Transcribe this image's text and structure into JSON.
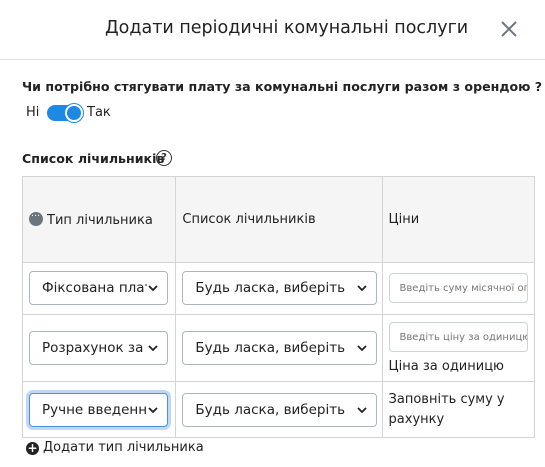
{
  "modal": {
    "title": "Додати періодичні комунальні послуги",
    "close_icon": "close-icon"
  },
  "billing": {
    "question": "Чи потрібно стягувати плату за комунальні послуги разом з орендою ?",
    "no_label": "Ні",
    "yes_label": "Так",
    "toggle_on": true
  },
  "meters": {
    "section_title": "Список лічильників",
    "help_symbol": "?",
    "headers": [
      "Тип лічильника",
      "Список лічильників",
      "Ціни"
    ],
    "rows": [
      {
        "type": "Фіксована плата",
        "meter": "Будь ласка, виберіть",
        "price_placeholder": "Введіть суму місячної оплати",
        "price_note": ""
      },
      {
        "type": "Розрахунок за одиницю",
        "meter": "Будь ласка, виберіть",
        "price_placeholder": "Введіть ціну за одиницю",
        "price_note": "Ціна за одиницю"
      },
      {
        "type": "Ручне введення",
        "meter": "Будь ласка, виберіть",
        "price_placeholder": "",
        "price_note": "Заповніть суму у рахунку"
      }
    ],
    "add_label": "Додати тип лічильника"
  },
  "colors": {
    "accent": "#1e88e5",
    "border": "#d4d4d4",
    "header_bg": "#f5f5f5"
  }
}
